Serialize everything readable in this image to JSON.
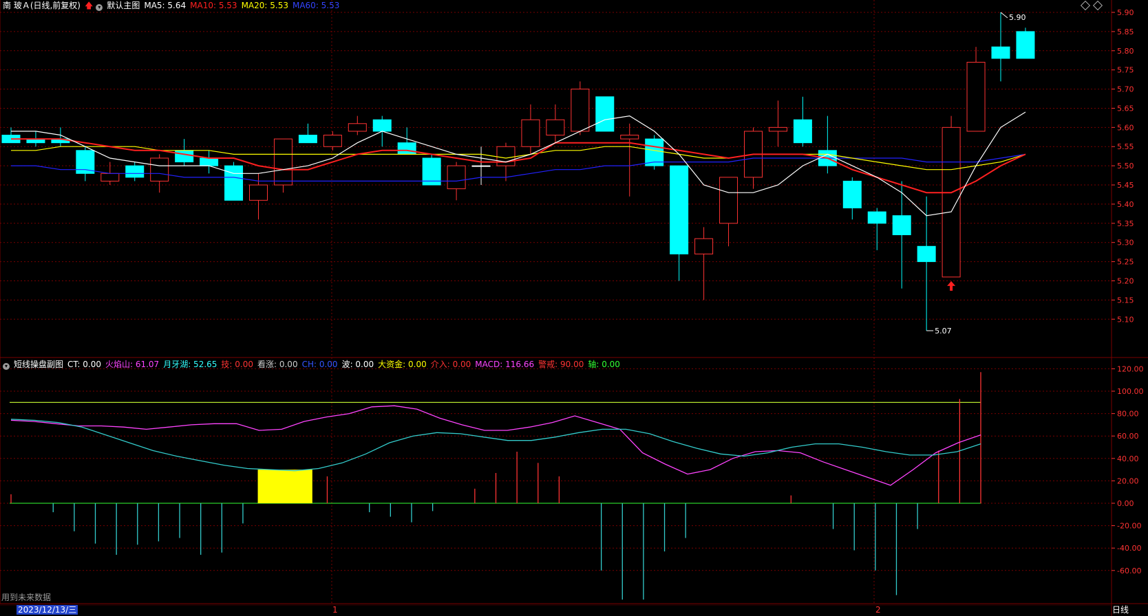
{
  "main_header": {
    "stock_name": "南 玻Ａ(日线,前复权)",
    "template_name": "默认主图",
    "ma5_label": "MA5: 5.64",
    "ma10_label": "MA10: 5.53",
    "ma20_label": "MA20: 5.53",
    "ma60_label": "MA60: 5.53"
  },
  "sub_header": {
    "indicator_name": "短线操盘副图",
    "items": [
      {
        "label": "CT: 0.00",
        "color": "#ffffff"
      },
      {
        "label": "火焰山: 61.07",
        "color": "#ff44ff"
      },
      {
        "label": "月牙湖: 52.65",
        "color": "#33ffff"
      },
      {
        "label": "技: 0.00",
        "color": "#ff3333"
      },
      {
        "label": "看涨: 0.00",
        "color": "#cccccc"
      },
      {
        "label": "CH: 0.00",
        "color": "#3355ff"
      },
      {
        "label": "波: 0.00",
        "color": "#ffffff"
      },
      {
        "label": "大资金: 0.00",
        "color": "#ffff00"
      },
      {
        "label": "介入: 0.00",
        "color": "#ff3333"
      },
      {
        "label": "MACD: 116.66",
        "color": "#ff44ff"
      },
      {
        "label": "警戒: 90.00",
        "color": "#ff3333"
      },
      {
        "label": "轴: 0.00",
        "color": "#33ff33"
      }
    ]
  },
  "footer": {
    "future_data_text": "用到未来数据",
    "date_label": "2023/12/13/三",
    "month_marks": [
      "1",
      "2"
    ],
    "period_button": "日线"
  },
  "colors": {
    "up": "#ff3333",
    "down": "#00ffff",
    "ma5": "#ffffff",
    "ma10": "#ff2020",
    "ma20": "#ffff00",
    "ma60": "#2222ff",
    "grid": "#7a0000",
    "axis_text": "#ff3333"
  },
  "chart_data": [
    {
      "type": "candlestick",
      "title": "南 玻Ａ(日线,前复权)",
      "ylim": [
        5.05,
        5.92
      ],
      "yticks": [
        5.1,
        5.15,
        5.2,
        5.25,
        5.3,
        5.35,
        5.4,
        5.45,
        5.5,
        5.55,
        5.6,
        5.65,
        5.7,
        5.75,
        5.8,
        5.85,
        5.9
      ],
      "max_label": "5.90",
      "min_label": "5.07",
      "candles": [
        {
          "o": 5.58,
          "h": 5.6,
          "l": 5.56,
          "c": 5.56
        },
        {
          "o": 5.57,
          "h": 5.59,
          "l": 5.55,
          "c": 5.56
        },
        {
          "o": 5.57,
          "h": 5.6,
          "l": 5.55,
          "c": 5.56
        },
        {
          "o": 5.54,
          "h": 5.55,
          "l": 5.46,
          "c": 5.48
        },
        {
          "o": 5.46,
          "h": 5.51,
          "l": 5.45,
          "c": 5.48
        },
        {
          "o": 5.5,
          "h": 5.51,
          "l": 5.46,
          "c": 5.47
        },
        {
          "o": 5.46,
          "h": 5.53,
          "l": 5.43,
          "c": 5.52
        },
        {
          "o": 5.54,
          "h": 5.57,
          "l": 5.5,
          "c": 5.51
        },
        {
          "o": 5.52,
          "h": 5.54,
          "l": 5.48,
          "c": 5.5
        },
        {
          "o": 5.5,
          "h": 5.51,
          "l": 5.41,
          "c": 5.41
        },
        {
          "o": 5.41,
          "h": 5.48,
          "l": 5.36,
          "c": 5.45
        },
        {
          "o": 5.45,
          "h": 5.57,
          "l": 5.43,
          "c": 5.57
        },
        {
          "o": 5.58,
          "h": 5.61,
          "l": 5.56,
          "c": 5.56
        },
        {
          "o": 5.55,
          "h": 5.59,
          "l": 5.54,
          "c": 5.58
        },
        {
          "o": 5.59,
          "h": 5.63,
          "l": 5.58,
          "c": 5.61
        },
        {
          "o": 5.62,
          "h": 5.63,
          "l": 5.55,
          "c": 5.59
        },
        {
          "o": 5.56,
          "h": 5.6,
          "l": 5.53,
          "c": 5.53
        },
        {
          "o": 5.52,
          "h": 5.53,
          "l": 5.45,
          "c": 5.45
        },
        {
          "o": 5.44,
          "h": 5.51,
          "l": 5.41,
          "c": 5.5
        },
        {
          "o": 5.5,
          "h": 5.55,
          "l": 5.45,
          "c": 5.5
        },
        {
          "o": 5.5,
          "h": 5.56,
          "l": 5.46,
          "c": 5.55
        },
        {
          "o": 5.55,
          "h": 5.66,
          "l": 5.53,
          "c": 5.62
        },
        {
          "o": 5.58,
          "h": 5.66,
          "l": 5.56,
          "c": 5.62
        },
        {
          "o": 5.59,
          "h": 5.72,
          "l": 5.58,
          "c": 5.7
        },
        {
          "o": 5.68,
          "h": 5.68,
          "l": 5.59,
          "c": 5.59
        },
        {
          "o": 5.57,
          "h": 5.61,
          "l": 5.42,
          "c": 5.58
        },
        {
          "o": 5.57,
          "h": 5.58,
          "l": 5.49,
          "c": 5.5
        },
        {
          "o": 5.5,
          "h": 5.5,
          "l": 5.2,
          "c": 5.27
        },
        {
          "o": 5.27,
          "h": 5.34,
          "l": 5.15,
          "c": 5.31
        },
        {
          "o": 5.35,
          "h": 5.47,
          "l": 5.29,
          "c": 5.47
        },
        {
          "o": 5.47,
          "h": 5.6,
          "l": 5.44,
          "c": 5.59
        },
        {
          "o": 5.59,
          "h": 5.67,
          "l": 5.55,
          "c": 5.6
        },
        {
          "o": 5.62,
          "h": 5.68,
          "l": 5.55,
          "c": 5.56
        },
        {
          "o": 5.54,
          "h": 5.63,
          "l": 5.48,
          "c": 5.5
        },
        {
          "o": 5.46,
          "h": 5.47,
          "l": 5.36,
          "c": 5.39
        },
        {
          "o": 5.38,
          "h": 5.39,
          "l": 5.28,
          "c": 5.35
        },
        {
          "o": 5.37,
          "h": 5.46,
          "l": 5.18,
          "c": 5.32
        },
        {
          "o": 5.29,
          "h": 5.42,
          "l": 5.07,
          "c": 5.25
        },
        {
          "o": 5.21,
          "h": 5.63,
          "l": 5.21,
          "c": 5.6
        },
        {
          "o": 5.59,
          "h": 5.81,
          "l": 5.59,
          "c": 5.77
        },
        {
          "o": 5.81,
          "h": 5.9,
          "l": 5.72,
          "c": 5.78
        },
        {
          "o": 5.85,
          "h": 5.86,
          "l": 5.78,
          "c": 5.78
        }
      ],
      "ma5": [
        5.59,
        5.59,
        5.58,
        5.55,
        5.52,
        5.51,
        5.5,
        5.5,
        5.5,
        5.48,
        5.48,
        5.49,
        5.5,
        5.52,
        5.56,
        5.59,
        5.57,
        5.55,
        5.53,
        5.52,
        5.51,
        5.53,
        5.56,
        5.59,
        5.62,
        5.63,
        5.59,
        5.53,
        5.45,
        5.43,
        5.43,
        5.45,
        5.5,
        5.53,
        5.5,
        5.47,
        5.43,
        5.37,
        5.38,
        5.5,
        5.6,
        5.64
      ],
      "ma10": [
        5.57,
        5.57,
        5.57,
        5.56,
        5.55,
        5.54,
        5.54,
        5.53,
        5.52,
        5.52,
        5.5,
        5.49,
        5.49,
        5.51,
        5.53,
        5.54,
        5.54,
        5.53,
        5.52,
        5.51,
        5.51,
        5.52,
        5.56,
        5.56,
        5.56,
        5.56,
        5.55,
        5.54,
        5.53,
        5.52,
        5.53,
        5.53,
        5.53,
        5.52,
        5.49,
        5.47,
        5.45,
        5.43,
        5.43,
        5.46,
        5.5,
        5.53
      ],
      "ma20": [
        5.54,
        5.54,
        5.55,
        5.55,
        5.55,
        5.55,
        5.54,
        5.54,
        5.54,
        5.53,
        5.53,
        5.53,
        5.53,
        5.53,
        5.53,
        5.53,
        5.53,
        5.53,
        5.53,
        5.53,
        5.52,
        5.53,
        5.54,
        5.54,
        5.55,
        5.55,
        5.54,
        5.53,
        5.52,
        5.52,
        5.53,
        5.53,
        5.53,
        5.53,
        5.52,
        5.51,
        5.5,
        5.49,
        5.49,
        5.5,
        5.51,
        5.53
      ],
      "ma60": [
        5.5,
        5.5,
        5.49,
        5.49,
        5.48,
        5.48,
        5.48,
        5.47,
        5.47,
        5.47,
        5.46,
        5.46,
        5.46,
        5.46,
        5.46,
        5.46,
        5.46,
        5.46,
        5.46,
        5.47,
        5.47,
        5.48,
        5.49,
        5.49,
        5.5,
        5.5,
        5.51,
        5.51,
        5.51,
        5.51,
        5.52,
        5.52,
        5.52,
        5.52,
        5.52,
        5.52,
        5.52,
        5.51,
        5.51,
        5.51,
        5.52,
        5.53
      ]
    },
    {
      "type": "line+bar",
      "title": "短线操盘副图",
      "ylim": [
        -85,
        122
      ],
      "yticks": [
        -60,
        -40,
        -20,
        0,
        20,
        40,
        60,
        80,
        100,
        120
      ],
      "alert_level": 90,
      "macd_bars": [
        8,
        0,
        -8,
        -25,
        -36,
        -46,
        -37,
        -34,
        -31,
        -46,
        -44,
        -18,
        0,
        0,
        22,
        24,
        0,
        -8,
        -12,
        -17,
        -7,
        0,
        13,
        27,
        46,
        36,
        24,
        0,
        -60,
        -86,
        -86,
        -43,
        -31,
        0,
        0,
        0,
        0,
        7,
        0,
        -23,
        -42,
        -60,
        -82,
        -23,
        47,
        93,
        117
      ],
      "huoyanshan": [
        74,
        73,
        71,
        69,
        69,
        68,
        66,
        68,
        70,
        71,
        71,
        65,
        66,
        73,
        77,
        80,
        86,
        87,
        84,
        76,
        70,
        65,
        65,
        68,
        72,
        78,
        72,
        66,
        45,
        35,
        26,
        30,
        40,
        46,
        47,
        45,
        37,
        30,
        23,
        16,
        30,
        45,
        54,
        61
      ],
      "yueyahu": [
        75,
        74,
        72,
        68,
        61,
        54,
        47,
        42,
        38,
        34,
        31,
        30,
        29,
        31,
        36,
        44,
        54,
        60,
        63,
        62,
        59,
        56,
        56,
        59,
        63,
        66,
        66,
        62,
        55,
        49,
        44,
        42,
        45,
        50,
        53,
        53,
        50,
        46,
        43,
        43,
        46,
        53
      ],
      "dazijin_block": {
        "from_index": 12,
        "to_index": 14,
        "value": 30
      }
    }
  ]
}
